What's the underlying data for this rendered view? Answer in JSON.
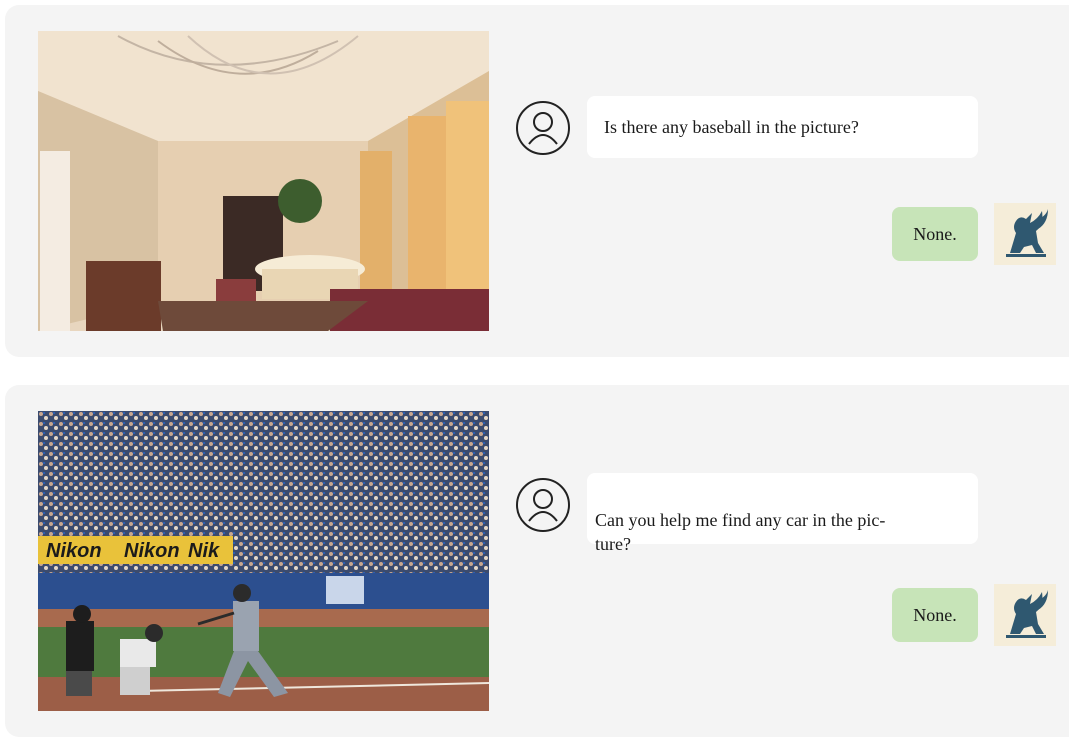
{
  "conversations": [
    {
      "image": {
        "icon": "living-room-photo"
      },
      "question": "Is there any baseball in the picture?",
      "answer": "None."
    },
    {
      "image": {
        "icon": "baseball-game-photo"
      },
      "question": "Can you help me find any car in the pic-\nture?",
      "answer": "None."
    }
  ],
  "icons": {
    "user": "user-avatar-icon",
    "assistant": "griffin-logo-icon"
  },
  "colors": {
    "panel_bg": "#f4f4f4",
    "question_bg": "#ffffff",
    "answer_bg": "#c7e4b8",
    "logo_bg": "#f5edd9",
    "logo_fg": "#2f5870"
  }
}
